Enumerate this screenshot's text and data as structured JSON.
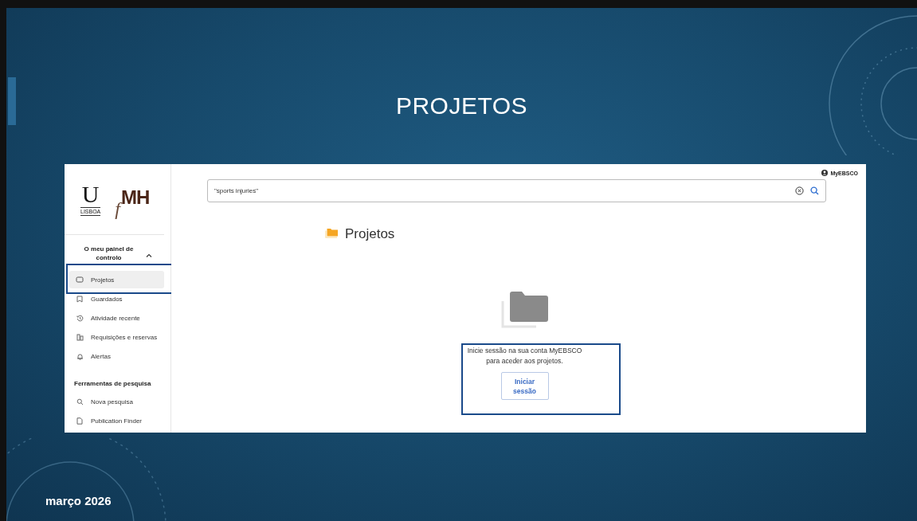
{
  "slide": {
    "title": "PROJETOS",
    "footer": "março 2026"
  },
  "logo": {
    "left_letter": "U",
    "left_caption": "LISBOA",
    "right_prefix": "f",
    "right_letters": "MH"
  },
  "sidebar": {
    "section": {
      "label": "O meu painel de controlo",
      "expanded": true
    },
    "items": [
      {
        "label": "Projetos",
        "kind": "projects",
        "selected": true
      },
      {
        "label": "Guardados",
        "kind": "bookmark",
        "selected": false
      },
      {
        "label": "Atividade recente",
        "kind": "history",
        "selected": false
      },
      {
        "label": "Requisições e reservas",
        "kind": "requests",
        "selected": false
      },
      {
        "label": "Alertas",
        "kind": "bell",
        "selected": false
      }
    ],
    "tools_heading": "Ferramentas de pesquisa",
    "tools": [
      {
        "label": "Nova pesquisa",
        "kind": "search",
        "selected": false
      },
      {
        "label": "Publication Finder",
        "kind": "document",
        "selected": false
      }
    ]
  },
  "header": {
    "account": "MyEBSCO"
  },
  "search": {
    "value": "\"sports injuries\""
  },
  "main": {
    "heading": "Projetos",
    "message_lines": [
      "Inicie sessão na sua conta MyEBSCO",
      "para aceder aos projetos."
    ],
    "button": "Iniciar sessão"
  }
}
